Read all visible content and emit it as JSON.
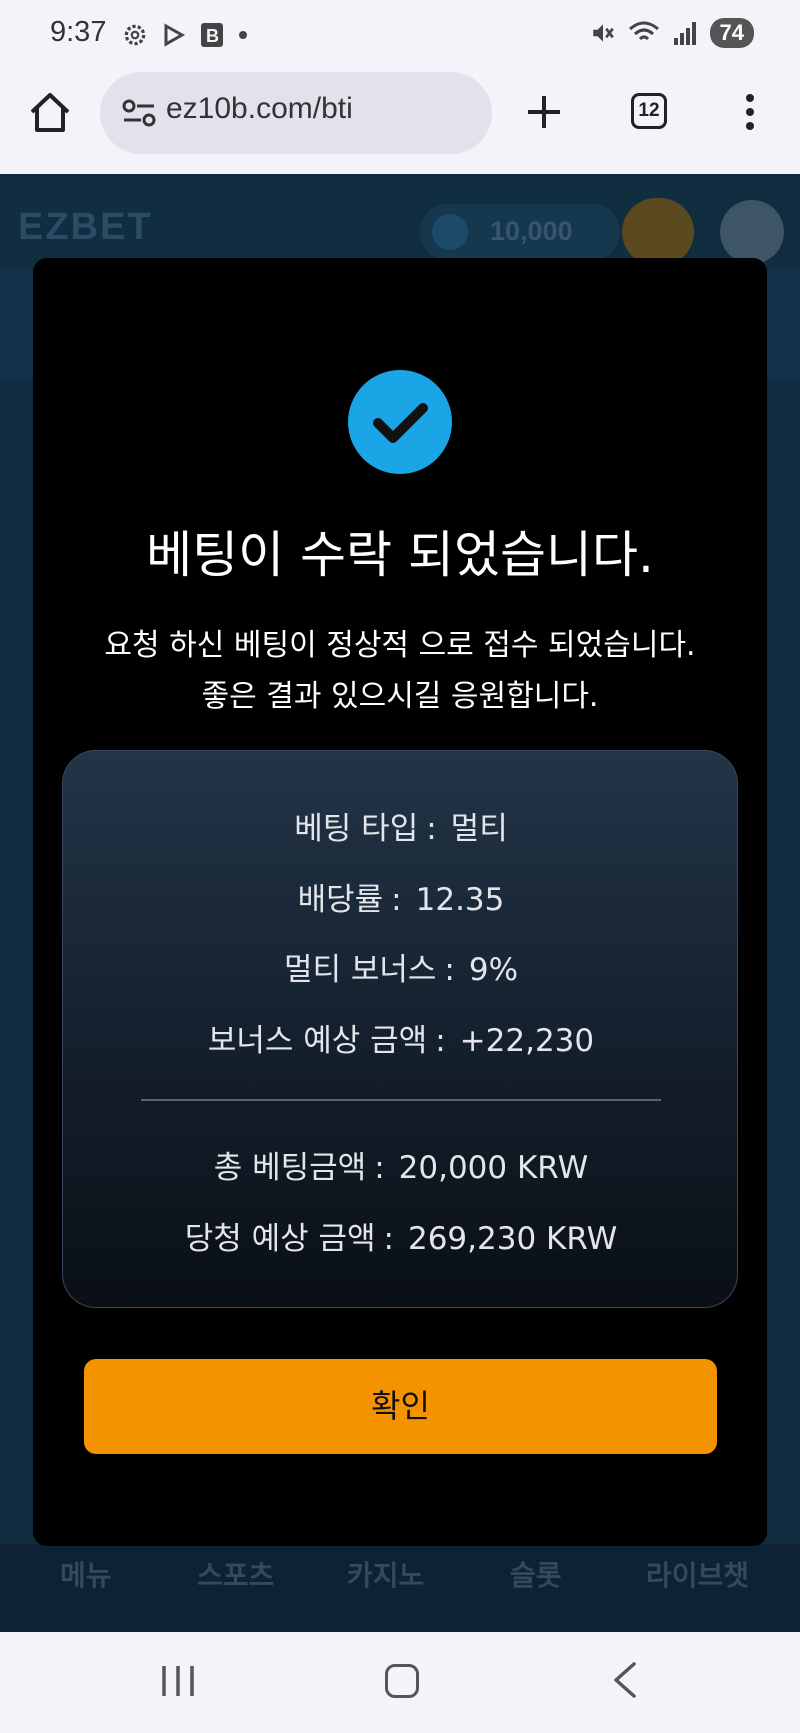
{
  "status_bar": {
    "time": "9:37",
    "battery": "74",
    "icons": [
      "settings-icon",
      "play-store-icon",
      "b-app-icon",
      "dot-icon",
      "mute-icon",
      "wifi-icon",
      "signal-icon"
    ]
  },
  "browser": {
    "url": "ez10b.com/bti",
    "tab_count": "12"
  },
  "site": {
    "logo": "EZBET",
    "balance": "10,000",
    "bottom_nav": [
      "메뉴",
      "스포츠",
      "카지노",
      "슬롯",
      "라이브챗"
    ]
  },
  "modal": {
    "title": "베팅이 수락 되었습니다.",
    "message": "요청 하신 베팅이 정상적 으로 접수 되었습니다. 좋은 결과 있으시길 응원합니다.",
    "details": [
      {
        "label": "베팅 타입",
        "value": "멀티"
      },
      {
        "label": "배당률",
        "value": "12.35"
      },
      {
        "label": "멀티 보너스",
        "value": "9%"
      },
      {
        "label": "보너스 예상 금액",
        "value": "+22,230"
      }
    ],
    "totals": [
      {
        "label": "총 베팅금액",
        "value": "20,000 KRW"
      },
      {
        "label": "당청 예상 금액",
        "value": "269,230 KRW"
      }
    ],
    "confirm_label": "확인",
    "accent_color": "#1aa6e6",
    "button_color": "#f59200"
  }
}
